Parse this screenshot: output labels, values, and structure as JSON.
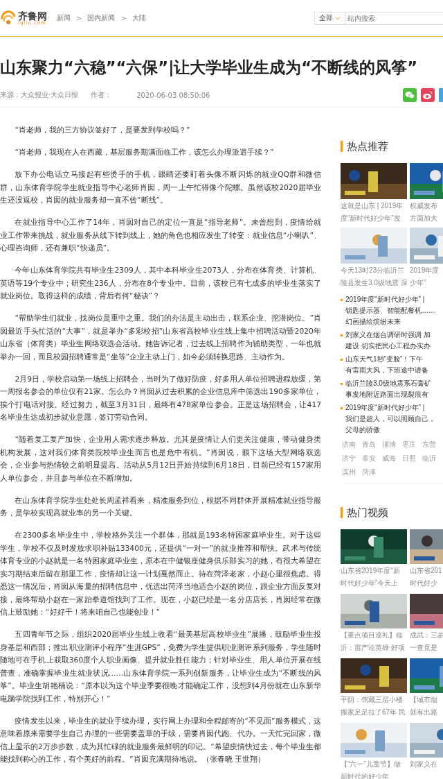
{
  "header": {
    "logo": {
      "name": "齐鲁网",
      "domain": "iqilu.com"
    },
    "breadcrumb": [
      {
        "label": "新闻"
      },
      {
        "label": "国内新闻"
      },
      {
        "label": "大陆"
      }
    ],
    "breadcrumb_separator": ">",
    "search": {
      "scope": "全部",
      "placeholder": "站内搜索"
    }
  },
  "article": {
    "title": "山东聚力“六稳”“六保”|让大学毕业生成为“不断线的风筝”",
    "meta": {
      "source": "来源：大众报业·大众日报",
      "author_label": "作者：",
      "date": "2020-06-03 08:50:06"
    },
    "paragraphs": [
      "“肖老师，我的三方协议签好了，是要发到学校吗？”",
      "“肖老师，我现在人在西藏，基层服务期满面临工作，该怎么办理派遣手续？”",
      "放下办公电话立马接起有些烫手的手机，眼睛还要盯着头像不断闪烁的就业QQ群和微信群，山东体育学院学生就业指导中心老师肖囡，周一上午忙得像个陀螺。虽然该校2020届毕业生还没返校，肖囡的就业服务却一直不曾“断线”。",
      "在就业指导中心工作了14年，肖囡对自己的定位一直是“指导老师”。未曾想到，疫情给就业工作带来挑战，就业服务从线下转到线上，她的角色也相应发生了转变：就业信息“小喇叭”、心理咨询师，还有兼职“快递员”。",
      "今年山东体育学院共有毕业生2309人，其中本科毕业生2073人，分布在体育类、计算机、英语等19个专业中；研究生236人，分布在8个专业中。目前，该校已有七成多的毕业生落实了就业岗位。取得这样的成绩，背后有何“秘诀”？",
      "“帮助学生们就业，找岗位是重中之重。我们的办法是主动出击，联系企业、挖潜岗位。”肖囡最近手头忙活的“大事”，就是举办“多彩校招”山东省高校毕业生线上集中招聘活动暨2020年山东省（体育类）毕业生网络双选会活动。她告诉记者，过去线上招聘作为辅助类型，一年也就举办一回，而且校园招聘通常是“坐等”企业主动上门，如今必须转换思路、主动作为。",
      "2月9日，学校启动第一场线上招聘会，当时为了做好防疫，好多用人单位招聘进程放缓，第一周报名参会的单位仅有21家。怎么办？肖囡从过去积累的企业信息库中筛选出190多家单位，挨个打电话对接。经过努力，截至3月31日，最终有478家单位参会。正是这场招聘会，让417名毕业生达成初步就业意愿，签订劳动合同。",
      "“随着复工复产加快，企业用人需求逐步释放。尤其是疫情让人们更关注健康，带动健身类机构发展，这对我们体育类院校毕业生而言也是危中有机。”肖囡说，眼下这场大型网络双选会，企业参与热情较之前明显提高。活动从5月12日开始持续到6月18日，目前已经有157家用人单位参会，并且参与单位在不断增加。",
      "在山东体育学院学生处处长周孟祥看来，精准服务到位，根据不同群体开展精准就业指导服务，是学校实现高就业率的另一个关键。",
      "在2300多名毕业生中，学校格外关注一个群体，那就是193名特困家庭毕业生。对于这些学生，学校不仅及时发放求职补贴133400元，还提供“一对一”的就业推荐和帮扶。武术与传统体育专业的小赵就是一名特困家庭毕业生，原本在中健银座健身俱乐部实习的她，有很大希望在实习期结束后留在那里工作，疫情却让这一计划戛然而止。待在菏泽老家，小赵心里很焦虑。得悉这一情况后，肖囡从海量的招聘信息中，优选出菏泽当地适合小赵的岗位，跟企业方面反复对接，最终帮助小赵在一家跆拳道馆找到了工作。现在，小赵已经是一名分店店长，肖囡经常在微信上鼓励她：“好好干！将来咱自己也能创业！”",
      "五四青年节之际，组织2020届毕业生线上收看“最美基层高校毕业生”展播，鼓励毕业生投身基层和西部；推出职业测评小程序“生涯GPS”，免费为学生提供职业测评系列服务，学生随时随地可在手机上获取360度个人职业画像、提升就业胜任能力；针对毕业生、用人单位开展在线普查，准确掌握毕业生就业状况……山东体育学院一系列创新服务，让毕业生成为“不断线的风筝”。毕业生胡艳楠说：“原本以为这个毕业季要很晚才能确定工作，没想到4月份就在山东新华电脑学院找到工作，特别开心！”",
      "疫情发生以来，毕业生的就业手续办理，实行网上办理和全程邮寄的“不见面”服务模式，这意味着原来需要学生自己办理的一些需要盖章的手续，需要肖囡代跑、代办。一天忙完回家，微信上显示的2万步步数，成为其忙碌的就业服务最鲜明的印记。“希望疫情快过去，每个毕业生都能找到称心的工作，有个美好的前程。”肖囡充满期待地说。（张春晓 王世翔）"
    ]
  },
  "sidebar": {
    "hot": {
      "title": "热点推荐",
      "cards": [
        {
          "caption": [
            "这就是山东 | 2019年",
            "度“新时代好少年”发"
          ]
        },
        {
          "caption": [
            "权威发布",
            "方面加大"
          ]
        },
        {
          "caption": [
            "今天13时23分临沂兰",
            "陵县发生3.0级地震 深"
          ]
        },
        {
          "caption": [
            "2019年度",
            "少年”"
          ]
        }
      ],
      "news": [
        {
          "lines": [
            "2019年度“新时代好少年” |",
            "钥匙提示器、智能配餐机……",
            "幻画描绘缤纷未来"
          ]
        },
        {
          "lines": [
            "刘家义在烟台调研时强调 加",
            "建设 切实把民心工程办实办"
          ]
        },
        {
          "lines": [
            "山东天气1秒“变脸”！下午",
            "有雷雨大风，下班途中请备"
          ]
        },
        {
          "lines": [
            "临沂兰陵3.0级地震系石膏矿",
            "事发地附近路面出现裂痕有"
          ]
        },
        {
          "lines": [
            "2019年度“新时代好少年” |",
            "我们是超人，可以照顾自己，",
            "父母的骄傲"
          ]
        }
      ],
      "cities": [
        [
          "济南",
          "青岛",
          "淄博",
          "枣庄",
          "东营"
        ],
        [
          "济宁",
          "泰安",
          "威海",
          "日照",
          "临沂"
        ],
        [
          "滨州",
          "菏泽"
        ]
      ]
    },
    "videos": {
      "title": "热门视频",
      "cards": [
        {
          "caption": [
            "山东省2019年度“新",
            "时代好少年”今天上"
          ]
        },
        {
          "caption": [
            "山东省201",
            "时代好少"
          ]
        },
        {
          "caption": [
            "【重点项目巡礼】临",
            "沂：亩产论英雄 好项"
          ]
        },
        {
          "caption": [
            "成武：三岁",
            "一查竟是"
          ]
        },
        {
          "caption": [
            "平阴：馆藏三层小楼",
            "搬家足足拉了67年 民"
          ]
        },
        {
          "caption": [
            "【城市烟",
            "就有出路"
          ]
        },
        {
          "caption": [
            "【“六一”儿童节】做",
            "新时代的好少年"
          ]
        },
        {
          "caption": [
            "刘家义在"
          ]
        }
      ]
    }
  }
}
